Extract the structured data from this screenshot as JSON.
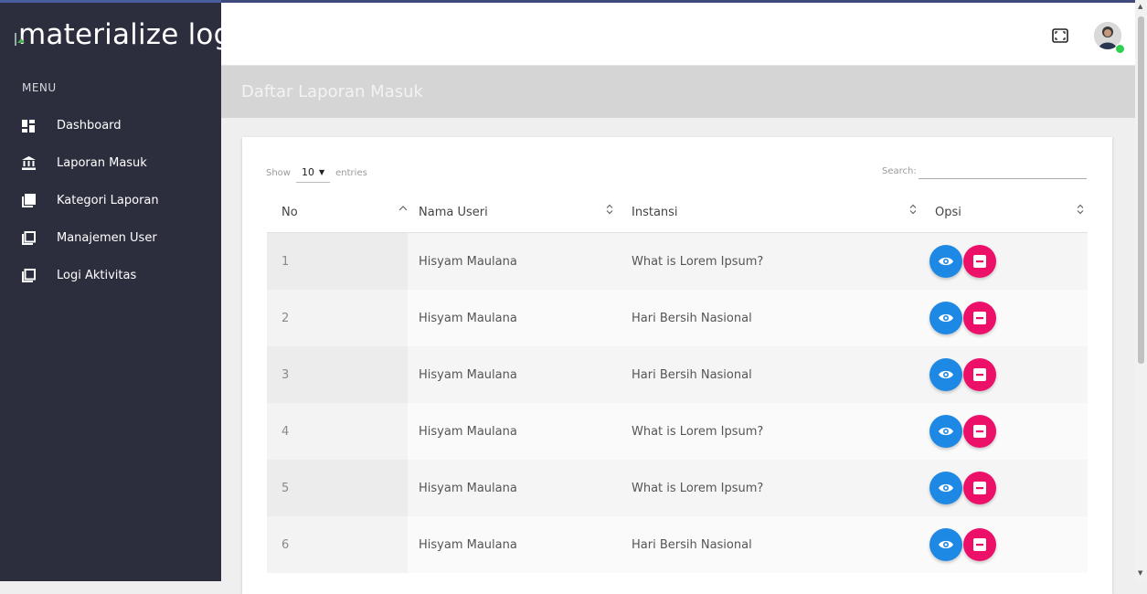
{
  "sidebar": {
    "logo_alt": "materialize logo",
    "menu_label": "MENU",
    "items": [
      {
        "label": "Dashboard",
        "icon": "dashboard-icon"
      },
      {
        "label": "Laporan Masuk",
        "icon": "bank-icon"
      },
      {
        "label": "Kategori Laporan",
        "icon": "library-icon"
      },
      {
        "label": "Manajemen User",
        "icon": "square-icon"
      },
      {
        "label": "Logi Aktivitas",
        "icon": "square-icon"
      }
    ]
  },
  "header": {
    "fullscreen_icon": "fullscreen-icon",
    "avatar_status_color": "#2ed14d"
  },
  "page": {
    "title": "Daftar Laporan Masuk"
  },
  "table_controls": {
    "show_label": "Show",
    "entries_value": "10",
    "entries_label": "entries",
    "search_label": "Search:"
  },
  "table": {
    "columns": [
      "No",
      "Nama Useri",
      "Instansi",
      "Opsi"
    ],
    "rows": [
      {
        "no": "1",
        "nama": "Hisyam Maulana",
        "instansi": "What is Lorem Ipsum?"
      },
      {
        "no": "2",
        "nama": "Hisyam Maulana",
        "instansi": "Hari Bersih Nasional"
      },
      {
        "no": "3",
        "nama": "Hisyam Maulana",
        "instansi": "Hari Bersih Nasional"
      },
      {
        "no": "4",
        "nama": "Hisyam Maulana",
        "instansi": "What is Lorem Ipsum?"
      },
      {
        "no": "5",
        "nama": "Hisyam Maulana",
        "instansi": "What is Lorem Ipsum?"
      },
      {
        "no": "6",
        "nama": "Hisyam Maulana",
        "instansi": "Hari Bersih Nasional"
      }
    ]
  },
  "colors": {
    "sidebar_bg": "#2c2e3e",
    "view_button": "#1e88e5",
    "delete_button": "#ec1068"
  }
}
